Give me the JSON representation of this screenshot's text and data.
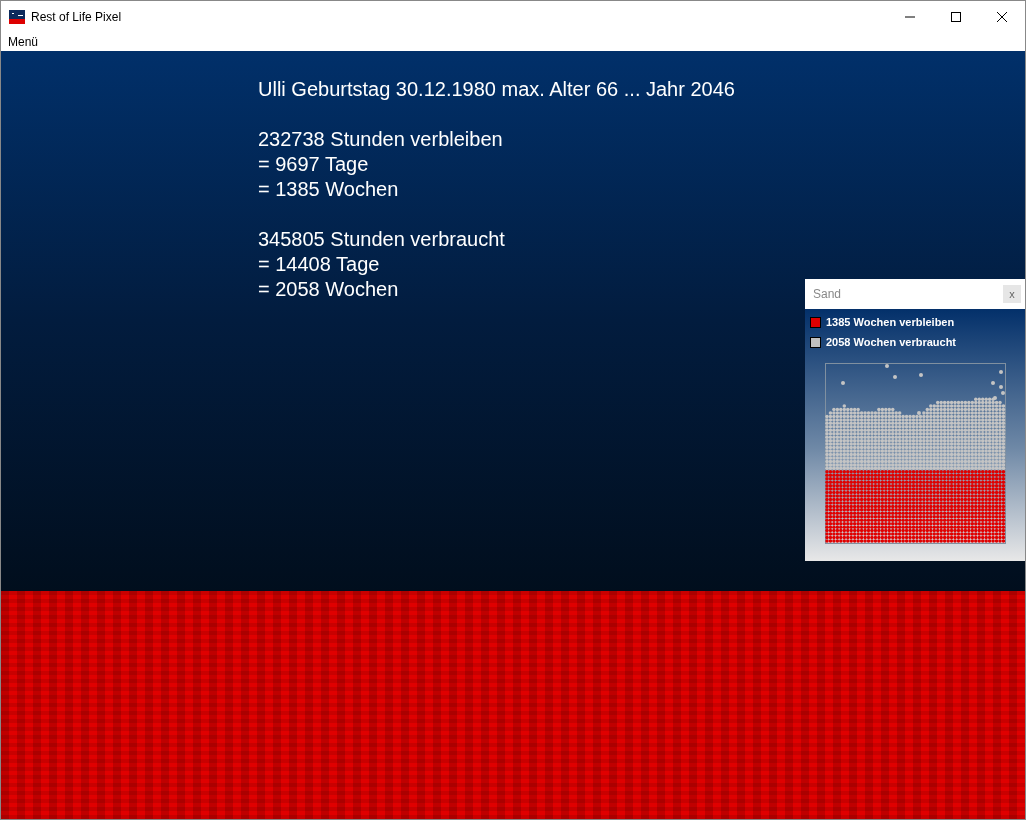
{
  "window": {
    "title": "Rest of Life Pixel"
  },
  "menu": [
    "Menü"
  ],
  "info": {
    "header": "Ulli Geburtstag 30.12.1980 max. Alter 66 ... Jahr 2046",
    "groups": [
      [
        "232738 Stunden verbleiben",
        "= 9697 Tage",
        "= 1385 Wochen"
      ],
      [
        "345805 Stunden verbraucht",
        "= 14408 Tage",
        "= 2058 Wochen"
      ]
    ]
  },
  "sand_panel": {
    "title": "Sand",
    "close": "x",
    "legend": [
      {
        "label": "1385 Wochen verbleiben",
        "color": "#e00000"
      },
      {
        "label": "2058 Wochen verbraucht",
        "color": "#c0c0c0"
      }
    ]
  }
}
